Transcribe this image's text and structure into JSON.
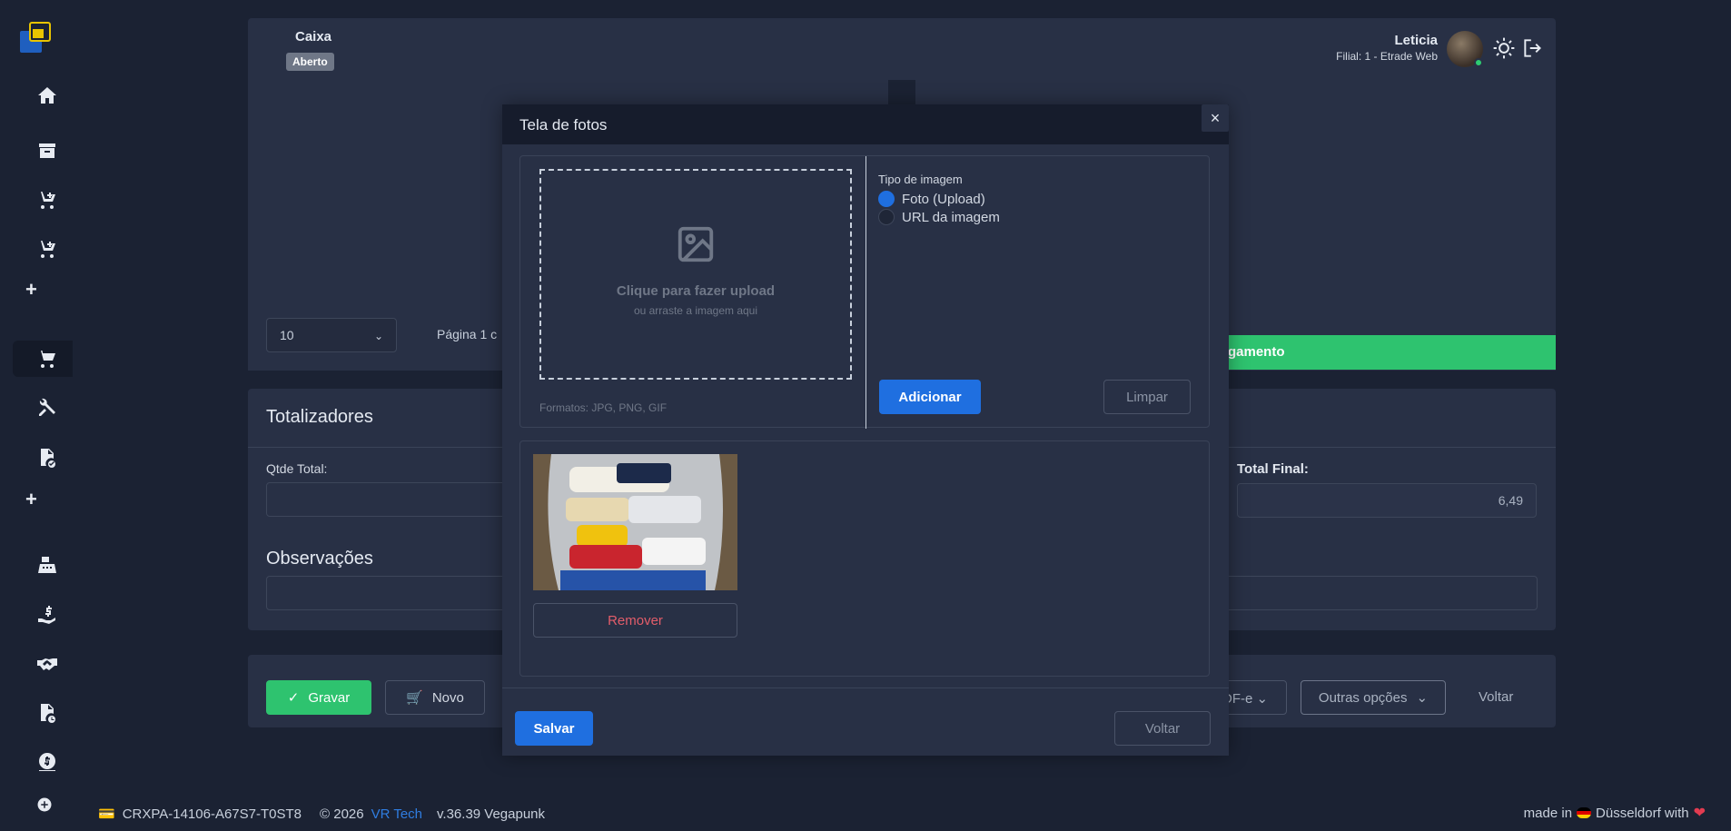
{
  "header": {
    "caixa_title": "Caixa",
    "caixa_status": "Aberto",
    "user_name": "Leticia",
    "user_filial": "Filial: 1 - Etrade Web"
  },
  "sidebar": {
    "icons": [
      "home-icon",
      "archive-icon",
      "cart-add-icon",
      "cart-add-icon",
      "plus-icon",
      "cart-icon",
      "tools-icon",
      "document-check-icon",
      "plus-icon",
      "cash-register-icon",
      "hand-money-icon",
      "handshake-icon",
      "document-clock-icon",
      "money-icon",
      "plus-circle-icon"
    ]
  },
  "list": {
    "page_size": "10",
    "page_info": "Página 1 c",
    "payment_button": "gamento"
  },
  "totals": {
    "title": "Totalizadores",
    "qtde_label": "Qtde Total:",
    "qtde_value": "",
    "final_label": "Total Final:",
    "final_value": "6,49",
    "obs_title": "Observações",
    "obs_value": ""
  },
  "actions": {
    "gravar": "Gravar",
    "novo": "Novo",
    "nfe": "DF-e",
    "outras": "Outras opções",
    "voltar": "Voltar"
  },
  "modal": {
    "title": "Tela de fotos",
    "close": "×",
    "dropzone_main": "Clique para fazer upload",
    "dropzone_sub": "ou arraste a imagem aqui",
    "formats": "Formatos: JPG, PNG, GIF",
    "tipo_label": "Tipo de imagem",
    "option_upload": "Foto (Upload)",
    "option_url": "URL da imagem",
    "selected_option": "Foto (Upload)",
    "adicionar": "Adicionar",
    "limpar": "Limpar",
    "remover": "Remover",
    "salvar": "Salvar",
    "voltar": "Voltar"
  },
  "footer": {
    "code": "CRXPA-14106-A67S7-T0ST8",
    "copyright": "© 2026",
    "company": "VR Tech",
    "version": "v.36.39 Vegapunk",
    "made_in": "made in",
    "city": "Düsseldorf with"
  },
  "colors": {
    "primary": "#1f6fe0",
    "success": "#2ec36f",
    "danger": "#e35d6a",
    "background": "#1b2233",
    "card": "#283045"
  }
}
